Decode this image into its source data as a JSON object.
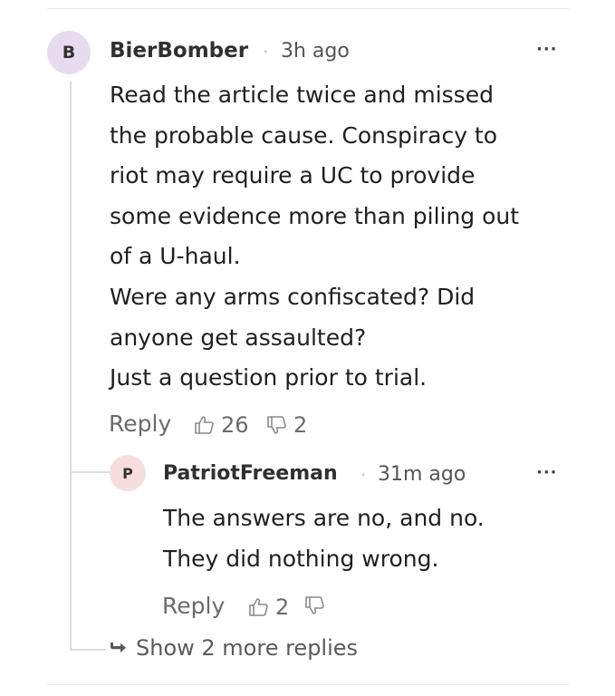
{
  "comment": {
    "avatar_initial": "B",
    "author": "BierBomber",
    "separator": "·",
    "time": "3h ago",
    "more_icon": "···",
    "body_lines": [
      "Read the article twice and missed",
      "the probable cause. Conspiracy to",
      "riot may require a UC to provide",
      "some evidence more than piling out",
      "of a U-haul.",
      "Were any arms confiscated? Did",
      "anyone get assaulted?",
      "Just a question prior to trial."
    ],
    "reply_label": "Reply",
    "upvotes": "26",
    "downvotes": "2",
    "colors": {
      "avatar_bg": "#e7dcef"
    }
  },
  "reply": {
    "avatar_initial": "P",
    "author": "PatriotFreeman",
    "separator": "·",
    "time": "31m ago",
    "more_icon": "···",
    "body_lines": [
      "The answers are no, and no.",
      "They did nothing wrong."
    ],
    "reply_label": "Reply",
    "upvotes": "2",
    "downvotes": "",
    "colors": {
      "avatar_bg": "#f6dede"
    }
  },
  "show_more": {
    "icon": "reply-arrow-icon",
    "label": "Show 2 more replies"
  }
}
